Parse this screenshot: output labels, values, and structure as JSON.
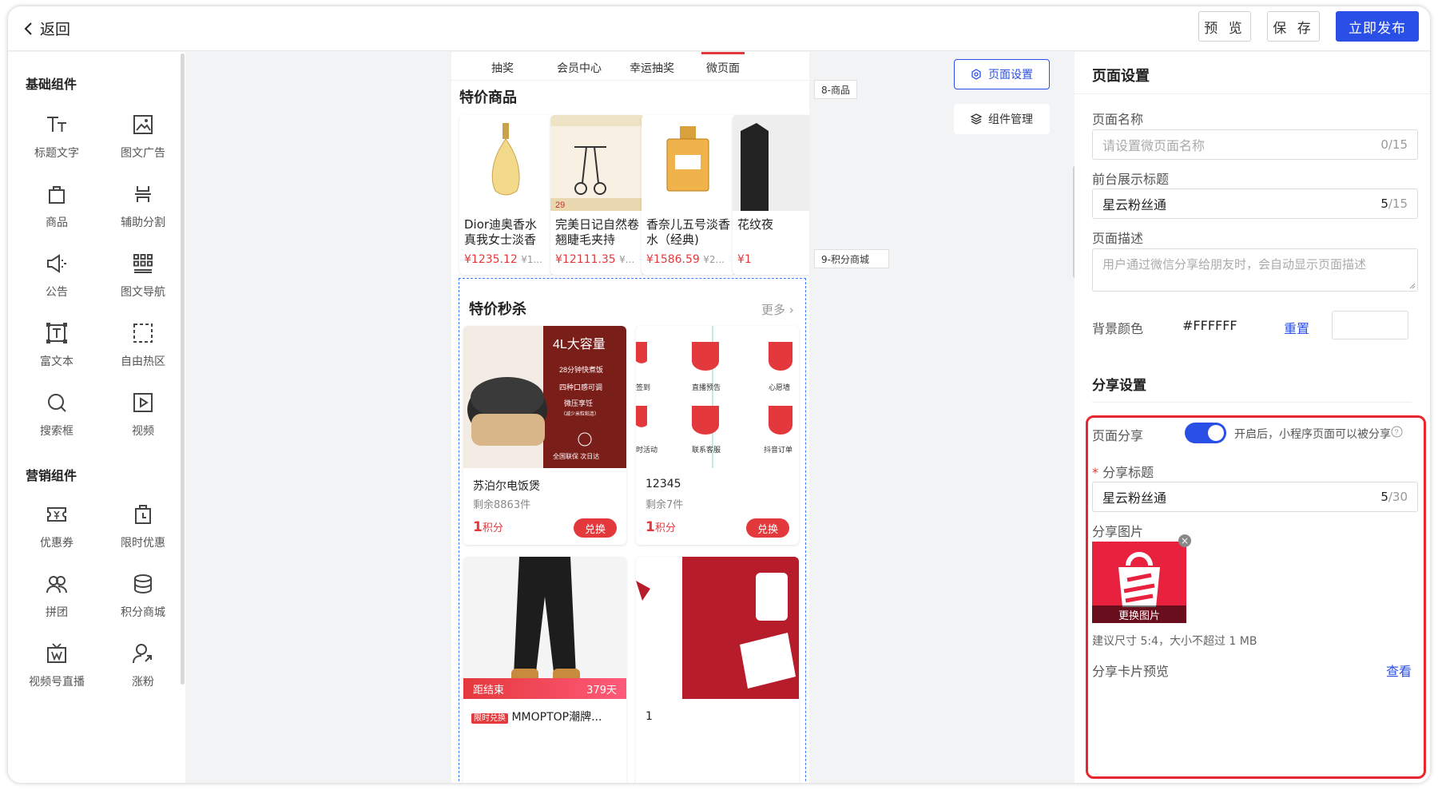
{
  "topbar": {
    "back_label": "返回",
    "preview": "预 览",
    "save": "保 存",
    "publish": "立即发布"
  },
  "left": {
    "basic_title": "基础组件",
    "basic_items": [
      {
        "label": "标题文字",
        "icon": "title-text-icon"
      },
      {
        "label": "图文广告",
        "icon": "image-ad-icon"
      },
      {
        "label": "商品",
        "icon": "bag-icon"
      },
      {
        "label": "辅助分割",
        "icon": "divider-icon"
      },
      {
        "label": "公告",
        "icon": "speaker-icon"
      },
      {
        "label": "图文导航",
        "icon": "grid-icon"
      },
      {
        "label": "富文本",
        "icon": "richtext-icon"
      },
      {
        "label": "自由热区",
        "icon": "hotzone-icon"
      },
      {
        "label": "搜索框",
        "icon": "search-icon"
      },
      {
        "label": "视频",
        "icon": "video-icon"
      }
    ],
    "marketing_title": "营销组件",
    "marketing_items": [
      {
        "label": "优惠券",
        "icon": "coupon-icon"
      },
      {
        "label": "限时优惠",
        "icon": "timer-icon"
      },
      {
        "label": "拼团",
        "icon": "group-icon"
      },
      {
        "label": "积分商城",
        "icon": "points-icon"
      },
      {
        "label": "视频号直播",
        "icon": "live-icon"
      },
      {
        "label": "涨粉",
        "icon": "follower-icon"
      }
    ]
  },
  "phone": {
    "tabs": [
      "抽奖",
      "会员中心",
      "幸运抽奖",
      "微页面"
    ],
    "section1_title": "特价商品",
    "tag1": "8-商品",
    "products": [
      {
        "name": "Dior迪奥香水真我女士淡香",
        "price": "¥1235.12",
        "old": "¥1..."
      },
      {
        "name": "完美日记自然卷翘睫毛夹持",
        "price": "¥12111.35",
        "old": "¥..."
      },
      {
        "name": "香奈儿五号淡香水（经典)",
        "price": "¥1586.59",
        "old": "¥2..."
      },
      {
        "name": "花纹夜",
        "price": "¥1",
        "old": ""
      }
    ],
    "tag2": "9-积分商城",
    "section2_title": "特价秒杀",
    "more": "更多",
    "goods": [
      {
        "name": "苏泊尔电饭煲",
        "stock": "剩余8863件",
        "points": "1",
        "unit": "积分",
        "btn": "兑换"
      },
      {
        "name": "12345",
        "stock": "剩余7件",
        "points": "1",
        "unit": "积分",
        "btn": "兑换"
      }
    ],
    "cooker": {
      "headline": "4L大容量",
      "l1": "28分钟快煮饭",
      "l2": "四种口感可调",
      "l3": "微压享饪",
      "l4": "（减少米粒粘连）",
      "l5": "全国联保 次日达"
    },
    "nav_icons": [
      "签到",
      "直播预告",
      "心愿墙",
      "时活动",
      "联系客服",
      "抖音订单"
    ],
    "countdown": {
      "label": "距结束",
      "days": "379天"
    },
    "bottom_left": {
      "badge": "限时兑换",
      "name": "MMOPTOP潮牌..."
    },
    "bottom_right": {
      "name": "1"
    }
  },
  "floating": {
    "page_settings": "页面设置",
    "component_mgmt": "组件管理"
  },
  "right": {
    "title": "页面设置",
    "page_name_label": "页面名称",
    "page_name_placeholder": "请设置微页面名称",
    "page_name_count": "0/15",
    "front_title_label": "前台展示标题",
    "front_title_value": "星云粉丝通",
    "front_title_count_cur": "5",
    "front_title_count_max": "/15",
    "desc_label": "页面描述",
    "desc_placeholder": "用户通过微信分享给朋友时，会自动显示页面描述",
    "bg_label": "背景颜色",
    "bg_value": "#FFFFFF",
    "bg_reset": "重置",
    "share": {
      "title": "分享设置",
      "page_share_label": "页面分享",
      "page_share_hint": "开启后，小程序页面可以被分享",
      "share_title_label": "分享标题",
      "required_mark": "*",
      "share_title_value": "星云粉丝通",
      "share_title_count_cur": "5",
      "share_title_count_max": "/30",
      "share_image_label": "分享图片",
      "change_image": "更换图片",
      "image_hint": "建议尺寸 5:4，大小不超过 1 MB",
      "card_preview_label": "分享卡片预览",
      "view_link": "查看"
    }
  },
  "colors": {
    "accent": "#2a4fe6",
    "red": "#e4393c",
    "highlight": "#e8262d"
  }
}
